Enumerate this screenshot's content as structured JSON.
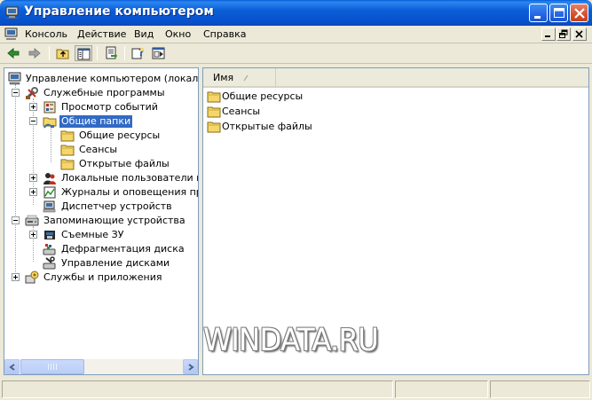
{
  "window": {
    "title": "Управление компьютером",
    "icon": "computer-management-icon"
  },
  "menu": {
    "items": [
      "Консоль",
      "Действие",
      "Вид",
      "Окно",
      "Справка"
    ]
  },
  "toolbar": {
    "buttons": [
      "back-arrow-icon",
      "forward-arrow-icon",
      "up-folder-icon",
      "show-hide-tree-icon",
      "export-list-icon",
      "help-icon",
      "properties-icon"
    ]
  },
  "tree": {
    "items": [
      {
        "label": "Управление компьютером (локальны",
        "icon": "computer-icon"
      },
      {
        "label": "Служебные программы",
        "icon": "tools-icon"
      },
      {
        "label": "Просмотр событий",
        "icon": "event-viewer-icon"
      },
      {
        "label": "Общие папки",
        "icon": "shared-folder-icon",
        "selected": true
      },
      {
        "label": "Общие ресурсы",
        "icon": "folder-icon"
      },
      {
        "label": "Сеансы",
        "icon": "folder-icon"
      },
      {
        "label": "Открытые файлы",
        "icon": "folder-icon"
      },
      {
        "label": "Локальные пользователи и гр",
        "icon": "users-icon"
      },
      {
        "label": "Журналы и оповещения произ",
        "icon": "performance-logs-icon"
      },
      {
        "label": "Диспетчер устройств",
        "icon": "device-manager-icon"
      },
      {
        "label": "Запоминающие устройства",
        "icon": "storage-icon"
      },
      {
        "label": "Съемные ЗУ",
        "icon": "removable-storage-icon"
      },
      {
        "label": "Дефрагментация диска",
        "icon": "defrag-icon"
      },
      {
        "label": "Управление дисками",
        "icon": "disk-management-icon"
      },
      {
        "label": "Службы и приложения",
        "icon": "services-icon"
      }
    ]
  },
  "list": {
    "column_header": "Имя",
    "sort_indicator": "/",
    "items": [
      {
        "label": "Общие ресурсы",
        "icon": "folder-icon"
      },
      {
        "label": "Сеансы",
        "icon": "folder-icon"
      },
      {
        "label": "Открытые файлы",
        "icon": "folder-icon"
      }
    ]
  },
  "watermark": "WINDATA.RU",
  "colors": {
    "titlebar": "#0B5ED7",
    "selection": "#316AC5",
    "face": "#ECE9D8"
  }
}
